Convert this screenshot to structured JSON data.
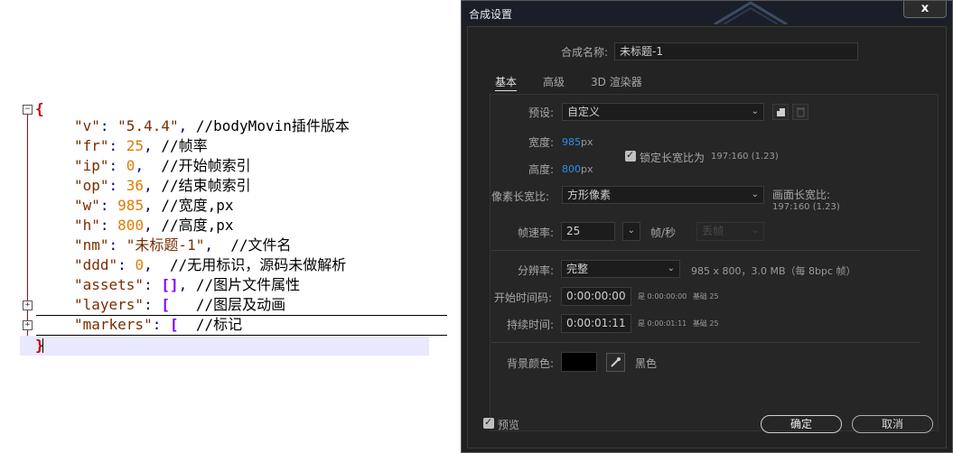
{
  "editor": {
    "lines": [
      {
        "open": "{"
      },
      {
        "key": "\"v\"",
        "colon": ": ",
        "value": "\"5.4.4\"",
        "comma": ",",
        "comment": " //bodyMovin插件版本"
      },
      {
        "key": "\"fr\"",
        "colon": ": ",
        "value": "25",
        "comma": ",",
        "comment": " //帧率"
      },
      {
        "key": "\"ip\"",
        "colon": ": ",
        "value": "0",
        "comma": ",",
        "comment": "  //开始帧索引"
      },
      {
        "key": "\"op\"",
        "colon": ": ",
        "value": "36",
        "comma": ",",
        "comment": " //结束帧索引"
      },
      {
        "key": "\"w\"",
        "colon": ": ",
        "value": "985",
        "comma": ",",
        "comment": " //宽度,px"
      },
      {
        "key": "\"h\"",
        "colon": ": ",
        "value": "800",
        "comma": ",",
        "comment": " //高度,px"
      },
      {
        "key": "\"nm\"",
        "colon": ": ",
        "value": "\"未标题-1\"",
        "comma": ",",
        "comment": "  //文件名"
      },
      {
        "key": "\"ddd\"",
        "colon": ": ",
        "value": "0",
        "comma": ",",
        "comment": "  //无用标识，源码未做解析"
      },
      {
        "key": "\"assets\"",
        "colon": ": ",
        "value": "[]",
        "comma": ",",
        "comment": " //图片文件属性"
      },
      {
        "key": "\"layers\"",
        "colon": ": ",
        "value": "[",
        "comma": "",
        "comment": "   //图层及动画"
      },
      {
        "key": "\"markers\"",
        "colon": ": ",
        "value": "[",
        "comma": "",
        "comment": "  //标记"
      },
      {
        "close": "}"
      }
    ],
    "fold_minus": "−",
    "fold_plus": "+"
  },
  "dialog": {
    "title": "合成设置",
    "close_label": "x",
    "comp_name_label": "合成名称:",
    "comp_name_value": "未标题-1",
    "tabs": [
      "基本",
      "高级",
      "3D 渲染器"
    ],
    "preset_label": "预设:",
    "preset_value": "自定义",
    "width_label": "宽度:",
    "width_value": "985",
    "width_unit": "px",
    "height_label": "高度:",
    "height_value": "800",
    "height_unit": "px",
    "lock_label": "锁定长宽比为",
    "lock_ratio": "197:160 (1.23)",
    "pixel_ratio_label": "像素长宽比:",
    "pixel_ratio_value": "方形像素",
    "frame_ratio_label": "画面长宽比:",
    "frame_ratio_value": "197:160 (1.23)",
    "fps_label": "帧速率:",
    "fps_value": "25",
    "fps_unit": "帧/秒",
    "drop_frame": "丢帧",
    "resolution_label": "分辨率:",
    "resolution_value": "完整",
    "resolution_info": "985 x 800，3.0 MB（每 8bpc 帧）",
    "start_tc_label": "开始时间码:",
    "start_tc_value": "0:00:00:00",
    "start_tc_info_prefix": "是",
    "start_tc_info": "0:00:00:00",
    "start_tc_base": "基础 25",
    "duration_label": "持续时间:",
    "duration_value": "0:00:01:11",
    "duration_info_prefix": "是",
    "duration_info": "0:00:01:11",
    "duration_base": "基础 25",
    "bg_color_label": "背景颜色:",
    "bg_color_name": "黑色",
    "bg_color_hex": "#000000",
    "preview_label": "预览",
    "ok_label": "确定",
    "cancel_label": "取消"
  }
}
